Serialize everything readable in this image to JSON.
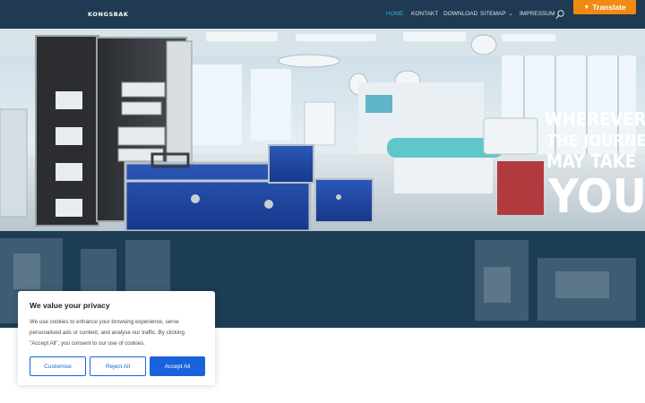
{
  "header": {
    "logo": "KONGSBAK",
    "nav": [
      {
        "label": "HOME",
        "active": true
      },
      {
        "label": "KONTAKT",
        "active": false
      },
      {
        "label": "DOWNLOAD",
        "active": false
      },
      {
        "label": "SITEMAP",
        "active": false
      },
      {
        "label": "IMPRESSUM",
        "active": false
      }
    ],
    "search_icon": "search-icon",
    "translate_label": "Translate"
  },
  "hero": {
    "slogan_lines": [
      "WHEREVER",
      "THE JOURNEY",
      "MAY TAKE",
      "YOU!"
    ]
  },
  "cookie": {
    "title": "We value your privacy",
    "text": "We use cookies to enhance your browsing experience, serve personalised ads or content, and analyse our traffic. By clicking \"Accept All\", you consent to our use of cookies.",
    "customise": "Customise",
    "reject": "Reject All",
    "accept": "Accept All"
  },
  "colors": {
    "header_bg": "#1f3a52",
    "nav_active": "#3ea6e6",
    "translate_bg": "#f08a12",
    "button_blue": "#1863dc"
  }
}
